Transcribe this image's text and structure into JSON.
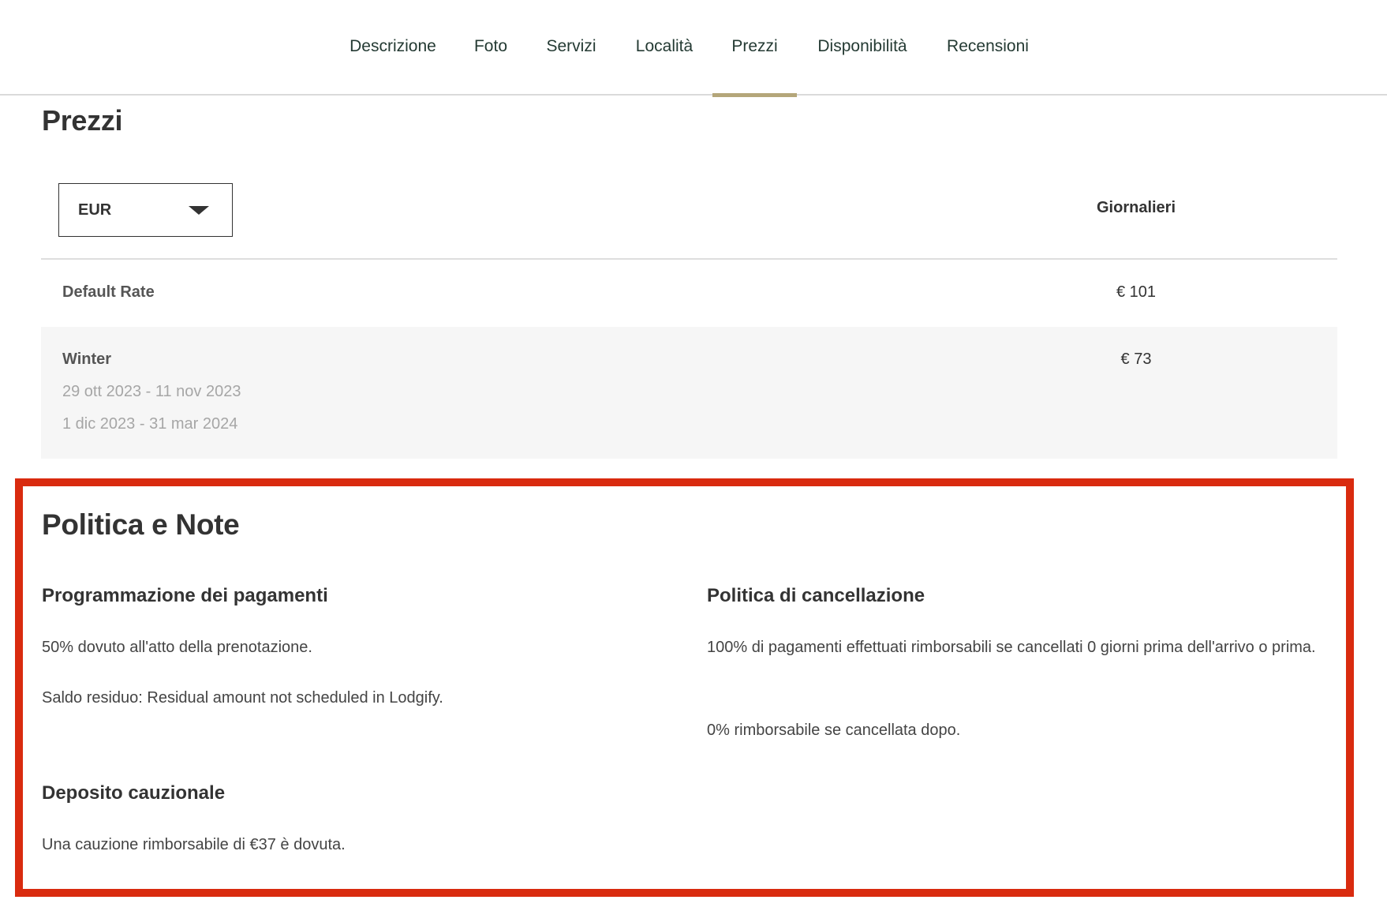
{
  "nav": {
    "tabs": [
      {
        "label": "Descrizione"
      },
      {
        "label": "Foto"
      },
      {
        "label": "Servizi"
      },
      {
        "label": "Località"
      },
      {
        "label": "Prezzi",
        "active": true
      },
      {
        "label": "Disponibilità"
      },
      {
        "label": "Recensioni"
      }
    ]
  },
  "prices": {
    "title": "Prezzi",
    "currency": "EUR",
    "column_header": "Giornalieri",
    "rates": [
      {
        "name": "Default Rate",
        "price": "€ 101",
        "dates": []
      },
      {
        "name": "Winter",
        "price": "€ 73",
        "dates": [
          "29 ott 2023 - 11 nov 2023",
          "1 dic 2023 - 31 mar 2024"
        ]
      }
    ]
  },
  "policy": {
    "title": "Politica e Note",
    "payment_schedule": {
      "heading": "Programmazione dei pagamenti",
      "lines": [
        "50% dovuto all'atto della prenotazione.",
        "Saldo residuo: Residual amount not scheduled in Lodgify."
      ]
    },
    "cancellation": {
      "heading": "Politica di cancellazione",
      "line1": "100% di pagamenti effettuati rimborsabili se cancellati 0 giorni prima dell'arrivo o prima.",
      "line2": "0% rimborsabile se cancellata dopo."
    },
    "deposit": {
      "heading": "Deposito cauzionale",
      "line": "Una cauzione rimborsabile di €37 è dovuta."
    }
  },
  "colors": {
    "highlight_border": "#d92b0f",
    "active_tab_underline": "#b4a67a",
    "nav_text": "#243a33"
  }
}
